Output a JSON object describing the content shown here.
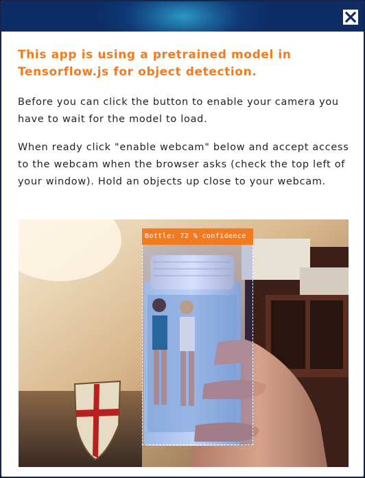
{
  "modal": {
    "close_icon": "close-x-icon"
  },
  "intro": {
    "title": "This app is using a pretrained model in Tensorflow.js for object detection.",
    "paragraph_1": "Before you can click the button to enable your camera you have to wait for the model to load.",
    "paragraph_2": "When ready click \"enable webcam\" below and accept access to the webcam when the browser asks (check the top left of your window). Hold an objects up close to your webcam."
  },
  "webcam": {
    "detection": {
      "label": "Bottle: 72 % confidence",
      "class": "Bottle",
      "confidence_percent": 72
    }
  },
  "colors": {
    "accent": "#f47a20",
    "header": "#0d2c63",
    "text": "#222222"
  }
}
